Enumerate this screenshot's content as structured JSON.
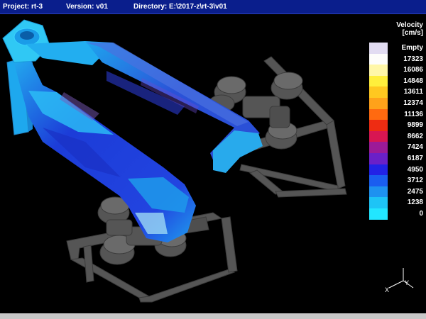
{
  "titlebar": {
    "project": "Project: rt-3",
    "version": "Version: v01",
    "directory": "Directory: E:\\2017-z\\rt-3\\v01"
  },
  "legend": {
    "title_line1": "Velocity",
    "title_line2": "[cm/s]",
    "entries": [
      {
        "label": "Empty",
        "color": "#e2dcf2"
      },
      {
        "label": "17323",
        "color": "#fdfdfb"
      },
      {
        "label": "16086",
        "color": "#fff7a8"
      },
      {
        "label": "14848",
        "color": "#ffef3c"
      },
      {
        "label": "13611",
        "color": "#ffc820"
      },
      {
        "label": "12374",
        "color": "#ffa21a"
      },
      {
        "label": "11136",
        "color": "#ff6a10"
      },
      {
        "label": "9899",
        "color": "#ee2c12"
      },
      {
        "label": "8662",
        "color": "#d81652"
      },
      {
        "label": "7424",
        "color": "#9c1a98"
      },
      {
        "label": "6187",
        "color": "#6a20c8"
      },
      {
        "label": "4950",
        "color": "#2222e6"
      },
      {
        "label": "3712",
        "color": "#1a5ef0"
      },
      {
        "label": "2475",
        "color": "#1e92f0"
      },
      {
        "label": "1238",
        "color": "#1ec4f6"
      },
      {
        "label": "0",
        "color": "#22e6ff"
      }
    ]
  },
  "axis": {
    "x_label": "X",
    "y_label": "Y"
  },
  "colors": {
    "titlebar_bg": "#0a1e8c",
    "viewport_bg": "#000000",
    "mold_gray": "#5a5a5a",
    "runner_cyan": "#22b4f0",
    "runner_blue": "#2048d8"
  }
}
